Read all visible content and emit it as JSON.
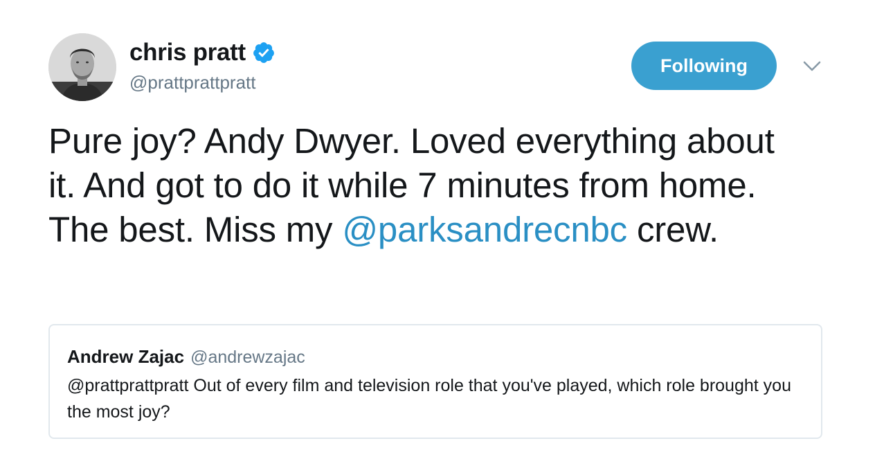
{
  "author": {
    "display_name": "chris pratt",
    "handle": "@prattprattpratt",
    "verified": true,
    "avatar_icon": "avatar-photo-icon"
  },
  "follow_button": {
    "label": "Following"
  },
  "menu": {
    "icon": "chevron-down-icon"
  },
  "tweet": {
    "text_before": "Pure joy? Andy Dwyer. Loved everything about it. And got to do it while 7 minutes from home. The best. Miss my ",
    "mention": "@parksandrecnbc",
    "text_after": " crew."
  },
  "quoted_tweet": {
    "display_name": "Andrew Zajac",
    "handle": "@andrewzajac",
    "text": "@prattprattpratt Out of every film and television role that you've played, which role brought you the most joy?"
  },
  "colors": {
    "follow_button_bg": "#3aa0d0",
    "mention": "#2a8fc4",
    "verified": "#1da1f2",
    "secondary_text": "#657786",
    "border": "#e1e8ed"
  }
}
